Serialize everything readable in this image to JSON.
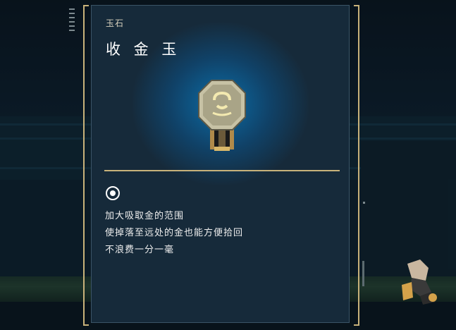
{
  "item": {
    "category": "玉石",
    "name": "收 金 玉",
    "description": [
      "加大吸取金的范围",
      "使掉落至远处的金也能方便拾回",
      "不浪费一分一毫"
    ]
  },
  "icons": {
    "item": "jade-stone-icon",
    "effect": "target-circle-icon"
  },
  "colors": {
    "frame_gold": "#c8b27a",
    "panel_bg": "#162a3a",
    "glow_blue": "#0a78b9",
    "text": "#eeeeee"
  }
}
